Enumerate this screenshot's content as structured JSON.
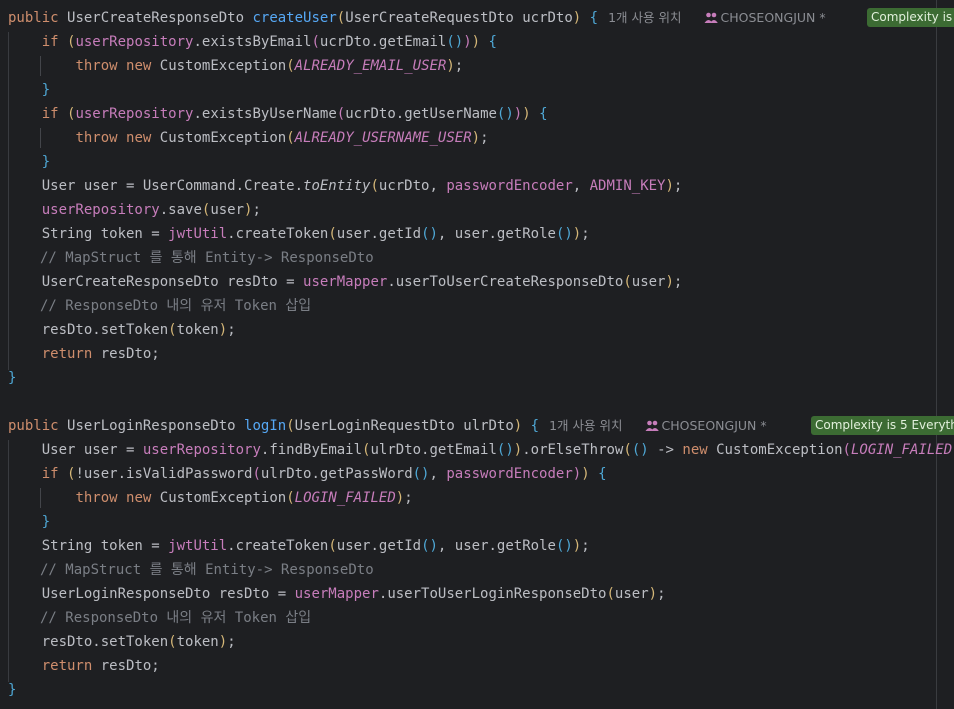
{
  "colors": {
    "background": "#1e1f22",
    "keyword": "#cf8e6d",
    "function": "#56a8f5",
    "field": "#c77dbb",
    "comment": "#7a7e85",
    "badge": "#3c6b33"
  },
  "method1": {
    "signature": {
      "kw_public": "public",
      "return_type": "UserCreateResponseDto",
      "name": "createUser",
      "param_type": "UserCreateRequestDto",
      "param_name": "ucrDto"
    },
    "usage_hint": "1개 사용 위치",
    "author_hint": "CHOSEONGJUN *",
    "complexity_badge": "Complexity is",
    "lines": {
      "l2": {
        "kw_if": "if",
        "field": "userRepository",
        "call": ".existsByEmail",
        "args": "ucrDto.getEmail"
      },
      "l3": {
        "kw_throw": "throw",
        "kw_new": "new",
        "cls": "CustomException",
        "const": "ALREADY_EMAIL_USER"
      },
      "l5": {
        "kw_if": "if",
        "field": "userRepository",
        "call": ".existsByUserName",
        "args": "ucrDto.getUserName"
      },
      "l6": {
        "kw_throw": "throw",
        "kw_new": "new",
        "cls": "CustomException",
        "const": "ALREADY_USERNAME_USER"
      },
      "l8": {
        "pre": "User user = UserCommand.Create.",
        "static_call": "toEntity",
        "arg1": "ucrDto, ",
        "field": "passwordEncoder",
        "sep": ", ",
        "const": "ADMIN_KEY"
      },
      "l9": {
        "field": "userRepository",
        "rest": ".save",
        "arg": "user"
      },
      "l10": {
        "pre": "String token = ",
        "field": "jwtUtil",
        "rest": ".createToken",
        "arg1": "user.getId",
        "arg2": ", user.getRole"
      },
      "l11": {
        "comment": "// MapStruct 를 통해 Entity-> ResponseDto"
      },
      "l12": {
        "pre": "UserCreateResponseDto resDto = ",
        "field": "userMapper",
        "rest": ".userToUserCreateResponseDto",
        "arg": "user"
      },
      "l13": {
        "comment": "// ResponseDto 내의 유저 Token 삽입"
      },
      "l14": {
        "text": "resDto.setToken",
        "arg": "token"
      },
      "l15": {
        "kw_return": "return",
        "rest": " resDto;"
      }
    }
  },
  "method2": {
    "signature": {
      "kw_public": "public",
      "return_type": "UserLoginResponseDto",
      "name": "logIn",
      "param_type": "UserLoginRequestDto",
      "param_name": "ulrDto"
    },
    "usage_hint": "1개 사용 위치",
    "author_hint": "CHOSEONGJUN *",
    "complexity_badge": "Complexity is 5 Everyth",
    "lines": {
      "l2": {
        "pre": "User user = ",
        "field": "userRepository",
        "call": ".findByEmail",
        "arg": "ulrDto.getEmail",
        "orelse": ".orElseThrow",
        "arrow": " -> ",
        "kw_new": "new",
        "cls": " CustomException",
        "const": "LOGIN_FAILED"
      },
      "l3": {
        "kw_if": "if",
        "pre": "!user.isValidPassword",
        "arg1": "ulrDto.getPassWord",
        "sep": ", ",
        "field": "passwordEncoder"
      },
      "l4": {
        "kw_throw": "throw",
        "kw_new": "new",
        "cls": "CustomException",
        "const": "LOGIN_FAILED"
      },
      "l6": {
        "pre": "String token = ",
        "field": "jwtUtil",
        "rest": ".createToken",
        "arg1": "user.getId",
        "arg2": ", user.getRole"
      },
      "l7": {
        "comment": "// MapStruct 를 통해 Entity-> ResponseDto"
      },
      "l8": {
        "pre": "UserLoginResponseDto resDto = ",
        "field": "userMapper",
        "rest": ".userToUserLoginResponseDto",
        "arg": "user"
      },
      "l9": {
        "comment": "// ResponseDto 내의 유저 Token 삽입"
      },
      "l10": {
        "text": "resDto.setToken",
        "arg": "token"
      },
      "l11": {
        "kw_return": "return",
        "rest": " resDto;"
      }
    }
  }
}
